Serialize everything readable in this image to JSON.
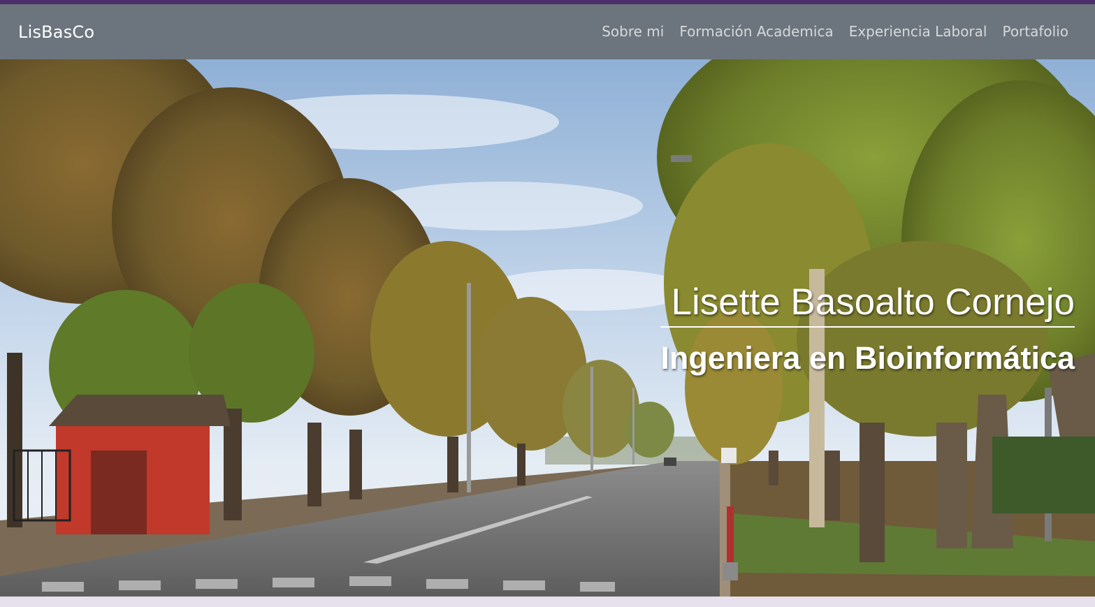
{
  "brand": "LisBasCo",
  "nav": {
    "items": [
      "Sobre mi",
      "Formación Academica",
      "Experiencia Laboral",
      "Portafolio"
    ]
  },
  "hero": {
    "name": "Lisette Basoalto Cornejo",
    "title": "Ingeniera en Bioinformática",
    "image": "tree-lined street in autumn"
  },
  "colors": {
    "top_strip": "#4a2f6b",
    "navbar": "#6c757d",
    "brand_text": "#ffffff",
    "nav_text": "#d6d9dc",
    "hero_text": "#ffffff"
  }
}
